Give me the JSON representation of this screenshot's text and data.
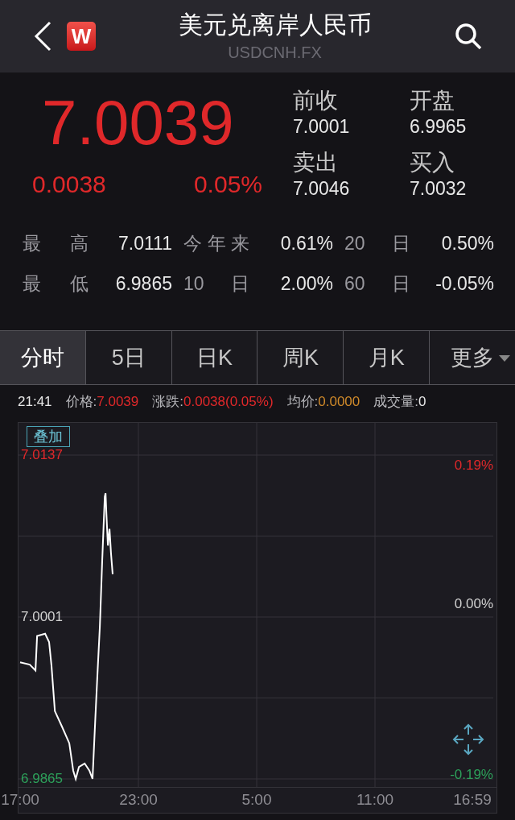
{
  "header": {
    "title": "美元兑离岸人民币",
    "subtitle": "USDCNH.FX",
    "logo": "W"
  },
  "quote": {
    "price": "7.0039",
    "change": "0.0038",
    "change_pct": "0.05%",
    "fields": [
      {
        "label": "前收",
        "value": "7.0001"
      },
      {
        "label": "开盘",
        "value": "6.9965"
      },
      {
        "label": "卖出",
        "value": "7.0046"
      },
      {
        "label": "买入",
        "value": "7.0032"
      }
    ]
  },
  "stats": [
    [
      {
        "label": "最 高",
        "value": "7.0111"
      },
      {
        "label": "今年来",
        "value": "0.61%"
      },
      {
        "label": "20 日",
        "value": "0.50%"
      }
    ],
    [
      {
        "label": "最 低",
        "value": "6.9865"
      },
      {
        "label": "10 日",
        "value": "2.00%"
      },
      {
        "label": "60 日",
        "value": "-0.05%"
      }
    ]
  ],
  "tabs": [
    {
      "label": "分时",
      "selected": true,
      "dropdown": false
    },
    {
      "label": "5日",
      "selected": false,
      "dropdown": false
    },
    {
      "label": "日K",
      "selected": false,
      "dropdown": false
    },
    {
      "label": "周K",
      "selected": false,
      "dropdown": false
    },
    {
      "label": "月K",
      "selected": false,
      "dropdown": false
    },
    {
      "label": "更多",
      "selected": false,
      "dropdown": true
    }
  ],
  "info_bar": {
    "time": "21:41",
    "items": [
      {
        "label": "价格:",
        "value": "7.0039",
        "color": "#e0282a"
      },
      {
        "label": "涨跌:",
        "value": "0.0038(0.05%)",
        "color": "#e0282a"
      },
      {
        "label": "均价:",
        "value": "0.0000",
        "color": "#d08a2a"
      },
      {
        "label": "成交量:",
        "value": "0",
        "color": "#e8e8e8"
      }
    ]
  },
  "overlay_button": "叠加",
  "later_time_labels": [
    "5:00",
    "11:00",
    "16:59"
  ],
  "percent_labels": [
    {
      "text": "0.19%",
      "kind": "up"
    },
    {
      "text": "0.00%",
      "kind": "flat"
    },
    {
      "text": "-0.19%",
      "kind": "down"
    }
  ],
  "chart_data": {
    "type": "line",
    "x": [
      17,
      17.49,
      17.78,
      17.86,
      18.27,
      18.47,
      18.59,
      18.76,
      19.12,
      19.49,
      19.69,
      19.82,
      19.98,
      20.27,
      20.51,
      20.67,
      20.8,
      20.92,
      21.04,
      21.16,
      21.29,
      21.33,
      21.37,
      21.45,
      21.53,
      21.61,
      21.69
    ],
    "series": [
      {
        "color": "#ffffff",
        "values": [
          6.9963,
          6.9961,
          6.9956,
          6.9985,
          6.9987,
          6.998,
          6.996,
          6.9922,
          6.9909,
          6.9895,
          6.9872,
          6.9865,
          6.9875,
          6.9878,
          6.9872,
          6.9865,
          6.9912,
          6.9953,
          6.9993,
          7.0048,
          7.0102,
          7.0105,
          7.0088,
          7.0061,
          7.0075,
          7.0054,
          7.0037
        ]
      }
    ],
    "xlim": [
      17,
      40.98
    ],
    "ylim": [
      6.9865,
      7.0137
    ],
    "xticks": [
      {
        "value": 17,
        "label": "17:00"
      },
      {
        "value": 23,
        "label": "23:00"
      }
    ],
    "yticks": [
      {
        "value": 7.0137,
        "label": "7.0137"
      },
      {
        "value": 7.0001,
        "label": "7.0001"
      },
      {
        "value": 6.9865,
        "label": "6.9865"
      }
    ]
  }
}
